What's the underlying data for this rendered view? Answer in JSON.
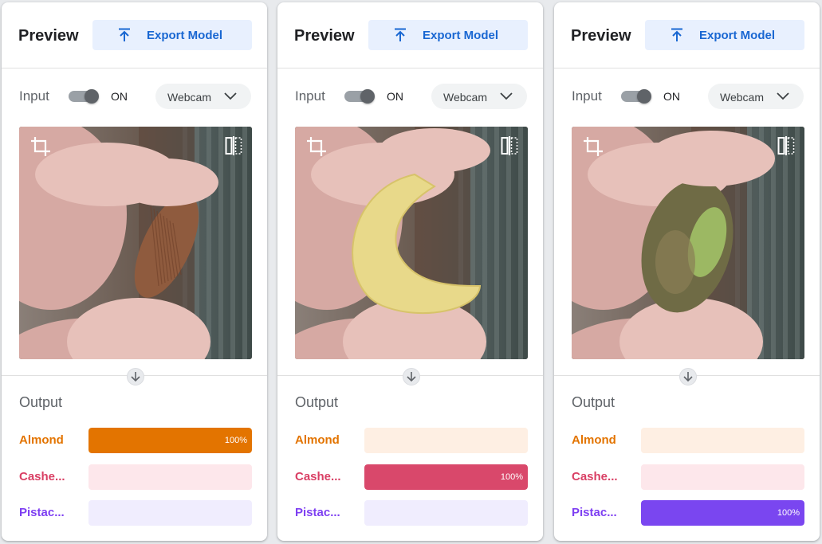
{
  "panels": [
    {
      "title": "Preview",
      "export_label": "Export Model",
      "input_label": "Input",
      "toggle_state": "ON",
      "source": "Webcam",
      "output_label": "Output",
      "subject": "almond",
      "classes": [
        {
          "name": "Almond",
          "confidence": 1.0,
          "pct_label": "100%"
        },
        {
          "name": "Cashe...",
          "confidence": 0.0,
          "pct_label": ""
        },
        {
          "name": "Pistac...",
          "confidence": 0.0,
          "pct_label": ""
        }
      ]
    },
    {
      "title": "Preview",
      "export_label": "Export Model",
      "input_label": "Input",
      "toggle_state": "ON",
      "source": "Webcam",
      "output_label": "Output",
      "subject": "cashew",
      "classes": [
        {
          "name": "Almond",
          "confidence": 0.0,
          "pct_label": ""
        },
        {
          "name": "Cashe...",
          "confidence": 1.0,
          "pct_label": "100%"
        },
        {
          "name": "Pistac...",
          "confidence": 0.0,
          "pct_label": ""
        }
      ]
    },
    {
      "title": "Preview",
      "export_label": "Export Model",
      "input_label": "Input",
      "toggle_state": "ON",
      "source": "Webcam",
      "output_label": "Output",
      "subject": "pistachio",
      "classes": [
        {
          "name": "Almond",
          "confidence": 0.0,
          "pct_label": ""
        },
        {
          "name": "Cashe...",
          "confidence": 0.0,
          "pct_label": ""
        },
        {
          "name": "Pistac...",
          "confidence": 1.0,
          "pct_label": "100%"
        }
      ]
    }
  ],
  "class_colors": {
    "Almond": {
      "text": "#e37400",
      "fill": "#e37400",
      "bg": "#feefe3"
    },
    "Cashe...": {
      "text": "#d93f64",
      "fill": "#d9486b",
      "bg": "#fde7eb"
    },
    "Pistac...": {
      "text": "#7e3ff2",
      "fill": "#7a46f0",
      "bg": "#f0edfe"
    }
  },
  "icons": {
    "export": "upload-icon",
    "dropdown": "chevron-down-icon",
    "crop": "crop-icon",
    "flip": "flip-icon",
    "arrow": "arrow-down-icon"
  }
}
